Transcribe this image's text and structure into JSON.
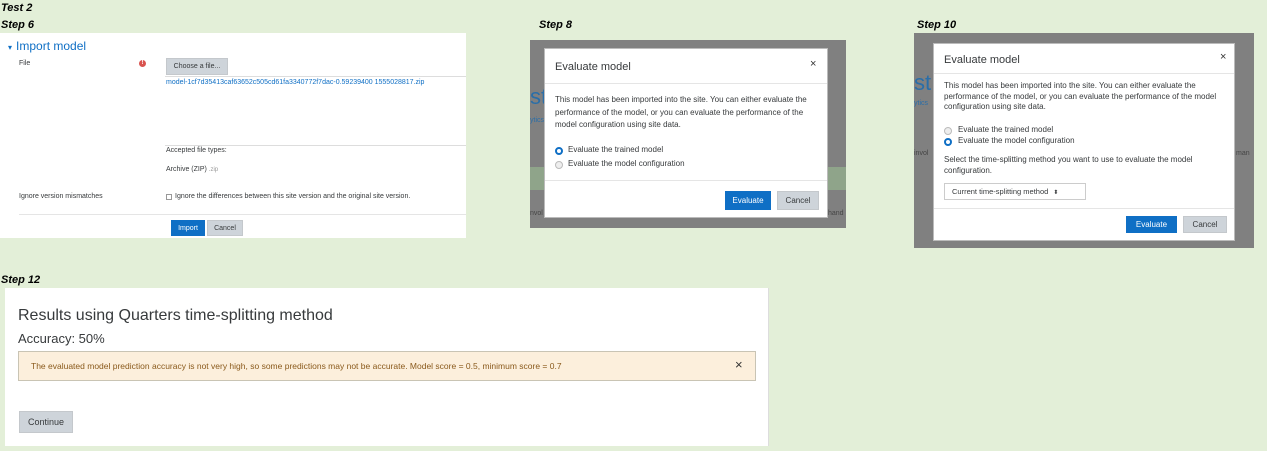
{
  "labels": {
    "test": "Test 2",
    "step6": "Step 6",
    "step8": "Step 8",
    "step10": "Step 10",
    "step12": "Step 12"
  },
  "step6": {
    "legend": "Import model",
    "file_label": "File",
    "choose_button": "Choose a file...",
    "file_name": "model-1cf7d35413caf63652c505cd61fa3340772f7dac-0.59239400 1555028817.zip",
    "accepted_label": "Accepted file types:",
    "accepted_type": "Archive (ZIP)",
    "accepted_ext": ".zip",
    "ignore_label": "Ignore version mismatches",
    "ignore_checkbox_label": "Ignore the differences between this site version and the original site version.",
    "import_button": "Import",
    "cancel_button": "Cancel"
  },
  "step8": {
    "title": "Evaluate model",
    "close": "×",
    "body": "This model has been imported into the site. You can either evaluate the performance of the model, or you can evaluate the performance of the model configuration using site data.",
    "option_trained": "Evaluate the trained model",
    "option_config": "Evaluate the model configuration",
    "evaluate_button": "Evaluate",
    "cancel_button": "Cancel",
    "bg_text_a": "st",
    "bg_text_b": "ytics",
    "bg_text_c": "nvol",
    "bg_text_d": "hand"
  },
  "step10": {
    "title": "Evaluate model",
    "close": "×",
    "body": "This model has been imported into the site. You can either evaluate the performance of the model, or you can evaluate the performance of the model configuration using site data.",
    "option_trained": "Evaluate the trained model",
    "option_config": "Evaluate the model configuration",
    "select_label": "Select the time-splitting method you want to use to evaluate the model configuration.",
    "select_value": "Current time-splitting method",
    "evaluate_button": "Evaluate",
    "cancel_button": "Cancel",
    "bg_text_a": "st",
    "bg_text_b": "ytics",
    "bg_text_c": "invol",
    "bg_text_d": "man"
  },
  "step12": {
    "heading": "Results using Quarters time-splitting method",
    "accuracy": "Accuracy: 50%",
    "alert": "The evaluated model prediction accuracy is not very high, so some predictions may not be accurate. Model score = 0.5, minimum score = 0.7",
    "alert_close": "×",
    "continue_button": "Continue"
  }
}
